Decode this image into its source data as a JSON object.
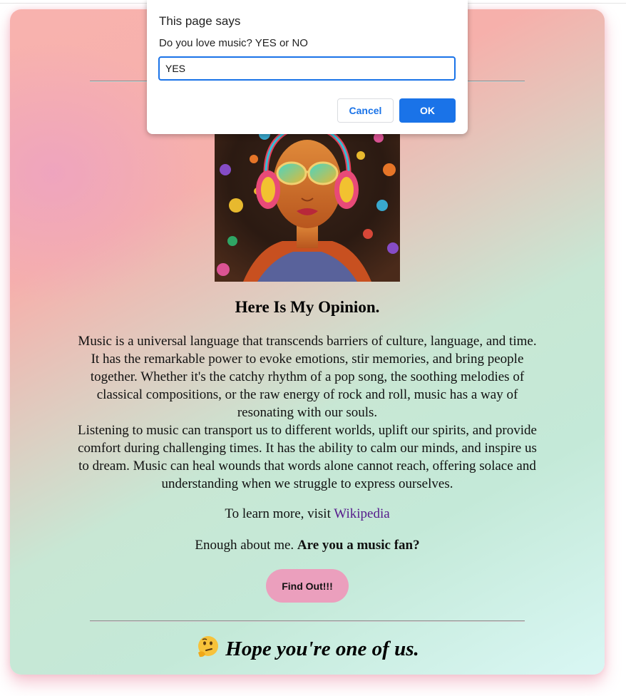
{
  "dialog": {
    "title": "This page says",
    "message": "Do you love music? YES or NO",
    "input_value": "YES",
    "cancel_label": "Cancel",
    "ok_label": "OK"
  },
  "page": {
    "opinion_heading": "Here Is My Opinion.",
    "paragraph_1": "Music is a universal language that transcends barriers of culture, language, and time. It has the remarkable power to evoke emotions, stir memories, and bring people together. Whether it's the catchy rhythm of a pop song, the soothing melodies of classical compositions, or the raw energy of rock and roll, music has a way of resonating with our souls.",
    "paragraph_2": "Listening to music can transport us to different worlds, uplift our spirits, and provide comfort during challenging times. It has the ability to calm our minds, and inspire us to dream. Music can heal wounds that words alone cannot reach, offering solace and understanding when we struggle to express ourselves.",
    "learn_more_prefix": "To learn more, visit ",
    "learn_more_link": "Wikipedia",
    "fan_prefix": "Enough about me. ",
    "fan_question": "Are you a music fan?",
    "find_out_label": "Find Out!!!",
    "closing_emoji": "thinking-face-icon",
    "closing_text": "Hope you're one of us."
  },
  "colors": {
    "button_pink": "#eb9fbd",
    "dialog_accent": "#1a73e8",
    "link_visited": "#551a8b"
  }
}
